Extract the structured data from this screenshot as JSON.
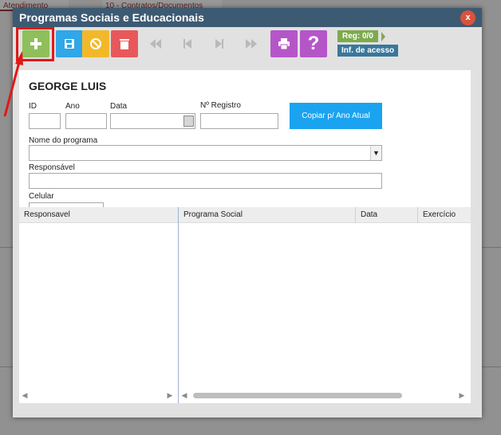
{
  "background": {
    "tab_1": "Atendimento",
    "tab_2": "10 - Contratos/Documentos"
  },
  "modal": {
    "title": "Programas Sociais e Educacionais",
    "close_label": "x"
  },
  "toolbar": {
    "buttons": [
      {
        "name": "add",
        "icon": "plus-icon",
        "color": "#8fbf5a"
      },
      {
        "name": "save",
        "icon": "floppy-icon",
        "color": "#2fa7e8"
      },
      {
        "name": "cancel",
        "icon": "cancel-icon",
        "color": "#f3b82a"
      },
      {
        "name": "delete",
        "icon": "trash-icon",
        "color": "#e8585a"
      },
      {
        "name": "first",
        "icon": "first-icon"
      },
      {
        "name": "prev",
        "icon": "prev-icon"
      },
      {
        "name": "next",
        "icon": "next-icon"
      },
      {
        "name": "last",
        "icon": "last-icon"
      },
      {
        "name": "print",
        "icon": "printer-icon",
        "color": "#b556c8"
      },
      {
        "name": "help",
        "icon": "question-icon",
        "color": "#b556c8"
      }
    ],
    "reg_label": "Reg: 0/0",
    "info_label": "Inf. de acesso"
  },
  "form": {
    "person_name": "GEORGE LUIS",
    "id_label": "ID",
    "ano_label": "Ano",
    "data_label": "Data",
    "registro_label": "Nº Registro",
    "copy_button": "Copiar p/ Ano Atual",
    "programa_label": "Nome do programa",
    "responsavel_label": "Responsável",
    "celular_label": "Celular",
    "id_value": "",
    "ano_value": "",
    "data_value": "",
    "registro_value": "",
    "programa_value": "",
    "responsavel_value": "",
    "celular_value": ""
  },
  "grid": {
    "left_columns": [
      "Responsavel"
    ],
    "right_columns": [
      "Programa Social",
      "Data",
      "Exercício"
    ],
    "rows": []
  }
}
